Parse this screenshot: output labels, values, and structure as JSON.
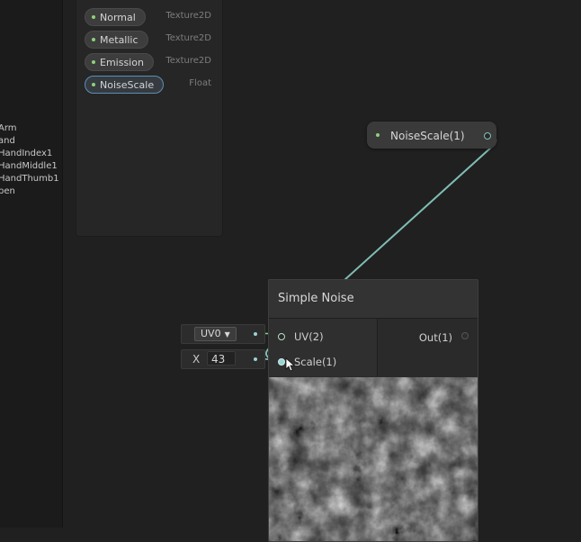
{
  "hierarchy": {
    "items": [
      "Arm",
      "and",
      "HandIndex1",
      "HandMiddle1",
      "HandThumb1",
      "pen"
    ]
  },
  "blackboard": {
    "properties": [
      {
        "name": "Normal",
        "type": "Texture2D",
        "selected": false
      },
      {
        "name": "Metallic",
        "type": "Texture2D",
        "selected": false
      },
      {
        "name": "Emission",
        "type": "Texture2D",
        "selected": false
      },
      {
        "name": "NoiseScale",
        "type": "Float",
        "selected": true
      }
    ]
  },
  "property_node": {
    "label": "NoiseScale(1)"
  },
  "simple_noise": {
    "title": "Simple Noise",
    "inputs": [
      "UV(2)",
      "Scale(1)"
    ],
    "output": "Out(1)"
  },
  "inline_inputs": {
    "uv_value": "UV0",
    "scale_axis": "X",
    "scale_value": "43"
  },
  "colors": {
    "wire": "#7fbdb3",
    "port_dot": "#8fd17a",
    "selection": "#5c8fb3"
  }
}
